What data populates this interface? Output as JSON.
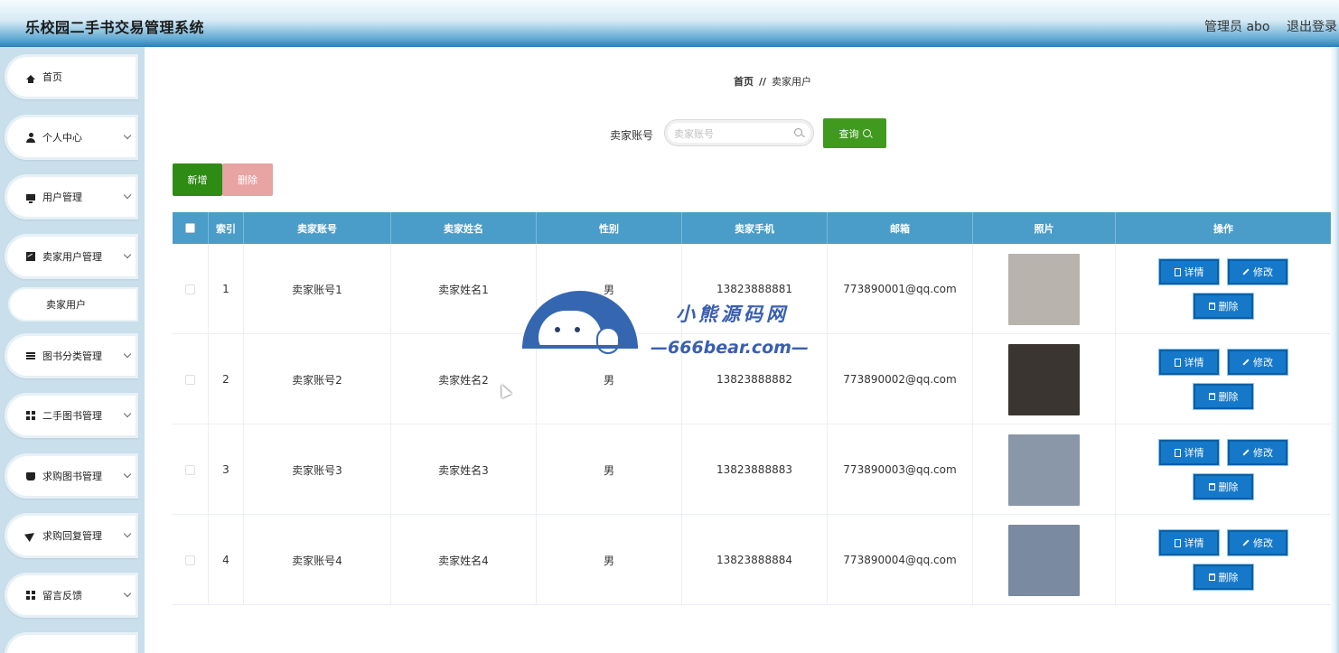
{
  "header": {
    "title": "乐校园二手书交易管理系统",
    "admin_label": "管理员 abo",
    "logout_label": "退出登录"
  },
  "sidebar": {
    "items": [
      {
        "label": "首页",
        "icon": "home-icon",
        "expandable": false
      },
      {
        "label": "个人中心",
        "icon": "user-icon",
        "expandable": true
      },
      {
        "label": "用户管理",
        "icon": "monitor-icon",
        "expandable": true
      },
      {
        "label": "卖家用户管理",
        "icon": "chart-icon",
        "expandable": true
      },
      {
        "label": "图书分类管理",
        "icon": "menu-icon",
        "expandable": true
      },
      {
        "label": "二手图书管理",
        "icon": "grid-icon",
        "expandable": true
      },
      {
        "label": "求购图书管理",
        "icon": "box-icon",
        "expandable": true
      },
      {
        "label": "求购回复管理",
        "icon": "send-icon",
        "expandable": true
      },
      {
        "label": "留言反馈",
        "icon": "grid-icon",
        "expandable": true
      }
    ],
    "sub_item": "卖家用户"
  },
  "breadcrumb": {
    "home": "首页",
    "separator": "//",
    "current": "卖家用户"
  },
  "search": {
    "label": "卖家账号",
    "placeholder": "卖家账号",
    "value": "",
    "button_label": "查询"
  },
  "actions": {
    "add_label": "新增",
    "delete_label": "删除"
  },
  "table": {
    "columns": [
      "索引",
      "卖家账号",
      "卖家姓名",
      "性别",
      "卖家手机",
      "邮箱",
      "照片",
      "操作"
    ],
    "rows": [
      {
        "index": "1",
        "account": "卖家账号1",
        "name": "卖家姓名1",
        "gender": "男",
        "phone": "13823888881",
        "email": "773890001@qq.com",
        "photo": "#b9b3ad"
      },
      {
        "index": "2",
        "account": "卖家账号2",
        "name": "卖家姓名2",
        "gender": "男",
        "phone": "13823888882",
        "email": "773890002@qq.com",
        "photo": "#3a3530"
      },
      {
        "index": "3",
        "account": "卖家账号3",
        "name": "卖家姓名3",
        "gender": "男",
        "phone": "13823888883",
        "email": "773890003@qq.com",
        "photo": "#8a97a8"
      },
      {
        "index": "4",
        "account": "卖家账号4",
        "name": "卖家姓名4",
        "gender": "男",
        "phone": "13823888884",
        "email": "773890004@qq.com",
        "photo": "#7a8aa0"
      }
    ],
    "ops": {
      "detail": "详情",
      "edit": "修改",
      "delete": "删除"
    }
  },
  "watermark": {
    "cn": "小熊源码网",
    "en": "—666bear.com—"
  },
  "colors": {
    "header_accent": "#2d86bd",
    "table_header": "#4a9cc9",
    "query_button": "#3f9a1d",
    "add_button": "#2e8b14",
    "delete_button": "#e8a3a3",
    "op_button": "#1578c9"
  }
}
